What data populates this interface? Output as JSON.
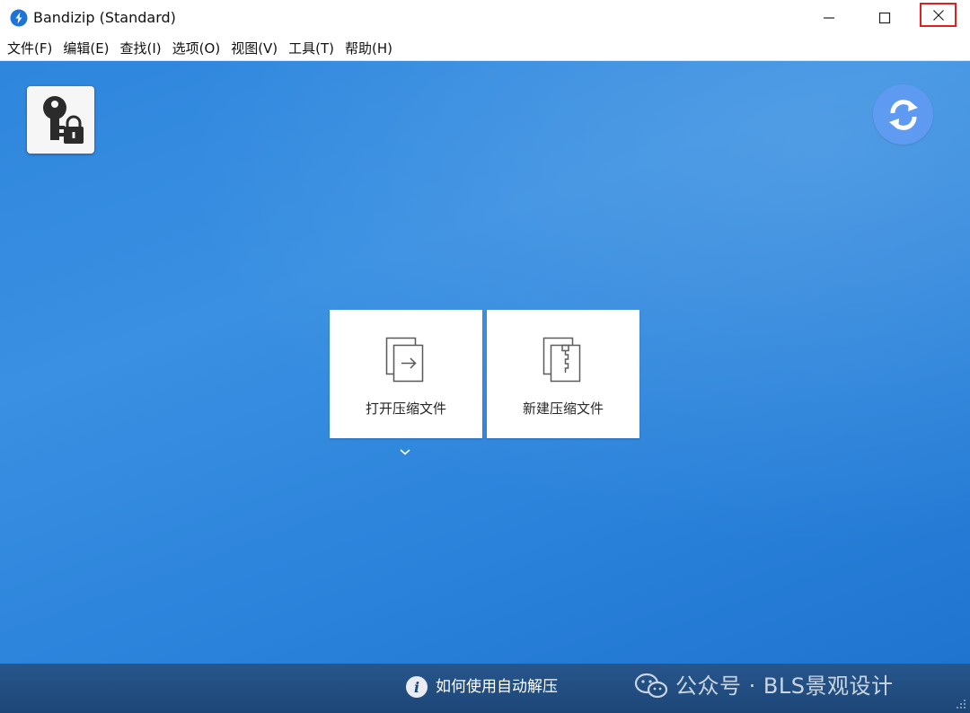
{
  "window": {
    "title": "Bandizip (Standard)",
    "icons": {
      "app": "bandizip-logo-icon",
      "minimize": "minimize-icon",
      "maximize": "maximize-icon",
      "close": "close-icon"
    },
    "close_highlight_color": "#e0201f"
  },
  "menu": [
    {
      "label": "文件(F)"
    },
    {
      "label": "编辑(E)"
    },
    {
      "label": "查找(I)"
    },
    {
      "label": "选项(O)"
    },
    {
      "label": "视图(V)"
    },
    {
      "label": "工具(T)"
    },
    {
      "label": "帮助(H)"
    }
  ],
  "main": {
    "background_color": "#2e86dd",
    "key_button_icon": "key-lock-icon",
    "refresh_button_icon": "refresh-icon",
    "tiles": [
      {
        "label": "打开压缩文件",
        "icon": "open-archive-icon"
      },
      {
        "label": "新建压缩文件",
        "icon": "new-archive-icon"
      }
    ],
    "dropdown_icon": "chevron-down-icon"
  },
  "bottom": {
    "info_text": "如何使用自动解压",
    "info_icon": "info-icon",
    "watermark_text": "公众号 · BLS景观设计",
    "watermark_icon": "wechat-icon"
  }
}
